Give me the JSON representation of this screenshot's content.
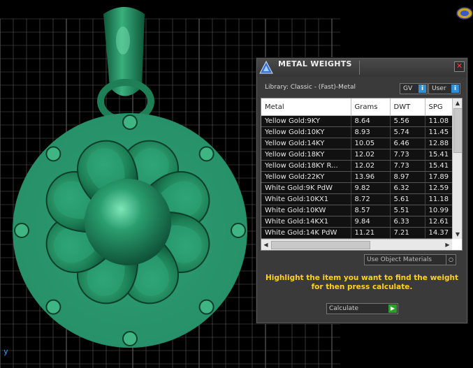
{
  "viewport": {
    "axis_label": "y"
  },
  "panel": {
    "title": "METAL WEIGHTS",
    "close_glyph": "✕",
    "library_label": "Library: Classic - (Fast)-Metal",
    "gv_label": "GV",
    "user_label": "User",
    "info_glyph": "i",
    "table": {
      "columns": [
        "Metal",
        "Grams",
        "DWT",
        "SPG"
      ],
      "rows": [
        [
          "Yellow Gold:9KY",
          "8.64",
          "5.56",
          "11.08"
        ],
        [
          "Yellow Gold:10KY",
          "8.93",
          "5.74",
          "11.45"
        ],
        [
          "Yellow Gold:14KY",
          "10.05",
          "6.46",
          "12.88"
        ],
        [
          "Yellow Gold:18KY",
          "12.02",
          "7.73",
          "15.41"
        ],
        [
          "Yellow Gold:18KY R...",
          "12.02",
          "7.73",
          "15.41"
        ],
        [
          "Yellow Gold:22KY",
          "13.96",
          "8.97",
          "17.89"
        ],
        [
          "White Gold:9K PdW",
          "9.82",
          "6.32",
          "12.59"
        ],
        [
          "White Gold:10KX1",
          "8.72",
          "5.61",
          "11.18"
        ],
        [
          "White Gold:10KW",
          "8.57",
          "5.51",
          "10.99"
        ],
        [
          "White Gold:14KX1",
          "9.84",
          "6.33",
          "12.61"
        ],
        [
          "White Gold:14K PdW",
          "11.21",
          "7.21",
          "14.37"
        ]
      ]
    },
    "material_select": "Use Object Materials",
    "instruction": "Highlight the item you want to find the weight for then press calculate.",
    "calculate_label": "Calculate"
  },
  "colors": {
    "model_green": "#1f8a5e",
    "instruction_yellow": "#ffd21a",
    "grid": "#5a5a5a"
  }
}
